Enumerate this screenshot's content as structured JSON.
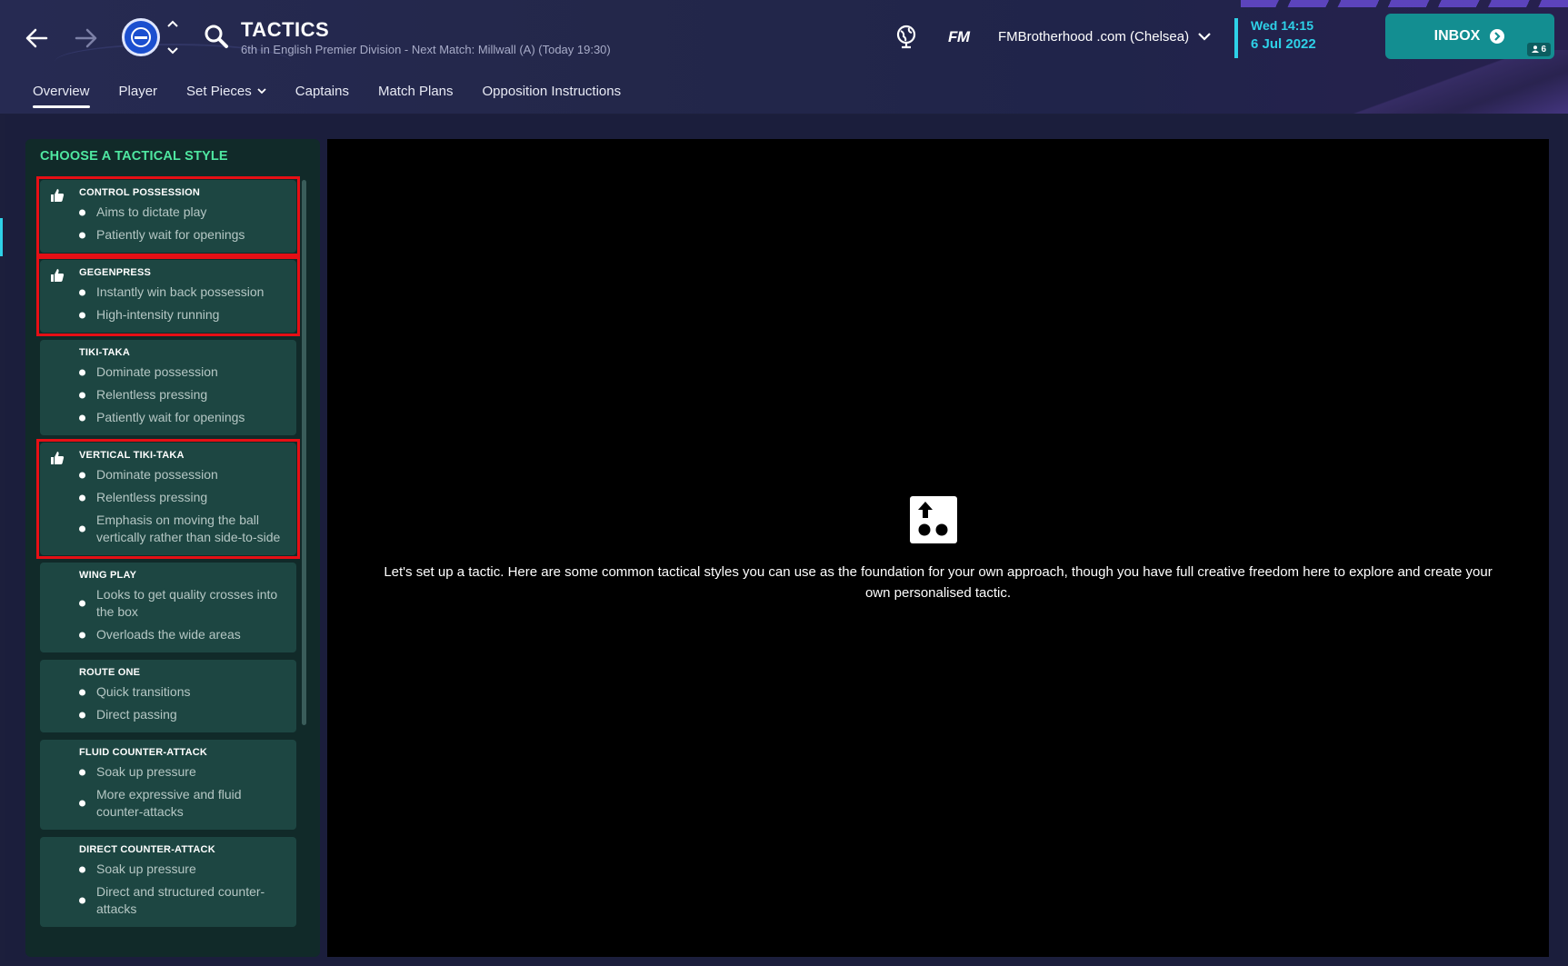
{
  "header": {
    "title": "TACTICS",
    "subtitle": "6th in English Premier Division - Next Match: Millwall (A) (Today 19:30)",
    "fm_logo": "FM",
    "profile": "FMBrotherhood .com (Chelsea)",
    "date_line1": "Wed 14:15",
    "date_line2": "6 Jul 2022",
    "inbox_label": "INBOX",
    "inbox_count": "6"
  },
  "tabs": [
    {
      "label": "Overview",
      "active": true
    },
    {
      "label": "Player",
      "active": false
    },
    {
      "label": "Set Pieces",
      "active": false,
      "dropdown": true
    },
    {
      "label": "Captains",
      "active": false
    },
    {
      "label": "Match Plans",
      "active": false
    },
    {
      "label": "Opposition Instructions",
      "active": false
    }
  ],
  "panel": {
    "title": "CHOOSE A TACTICAL STYLE",
    "styles": [
      {
        "name": "CONTROL POSSESSION",
        "recommended": true,
        "highlighted": true,
        "points": [
          "Aims to dictate play",
          "Patiently wait for openings"
        ]
      },
      {
        "name": "GEGENPRESS",
        "recommended": true,
        "highlighted": true,
        "points": [
          "Instantly win back possession",
          "High-intensity running"
        ]
      },
      {
        "name": "TIKI-TAKA",
        "recommended": false,
        "highlighted": false,
        "points": [
          "Dominate possession",
          "Relentless pressing",
          "Patiently wait for openings"
        ]
      },
      {
        "name": "VERTICAL TIKI-TAKA",
        "recommended": true,
        "highlighted": true,
        "points": [
          "Dominate possession",
          "Relentless pressing",
          "Emphasis on moving the ball vertically rather than side-to-side"
        ]
      },
      {
        "name": "WING PLAY",
        "recommended": false,
        "highlighted": false,
        "points": [
          "Looks to get quality crosses into the box",
          "Overloads the wide areas"
        ]
      },
      {
        "name": "ROUTE ONE",
        "recommended": false,
        "highlighted": false,
        "points": [
          "Quick transitions",
          "Direct passing"
        ]
      },
      {
        "name": "FLUID COUNTER-ATTACK",
        "recommended": false,
        "highlighted": false,
        "points": [
          "Soak up pressure",
          "More expressive and fluid counter-attacks"
        ]
      },
      {
        "name": "DIRECT COUNTER-ATTACK",
        "recommended": false,
        "highlighted": false,
        "points": [
          "Soak up pressure",
          "Direct and structured counter-attacks"
        ]
      }
    ]
  },
  "content": {
    "intro_text": "Let's set up a tactic. Here are some common tactical styles you can use as the foundation for your own approach, though you have full creative freedom here to explore and create your own personalised tactic."
  },
  "colors": {
    "accent_cyan": "#2ed1e8",
    "panel_title_green": "#4fe7a1",
    "inbox_teal": "#138e91",
    "highlight_red": "#e60f15"
  }
}
